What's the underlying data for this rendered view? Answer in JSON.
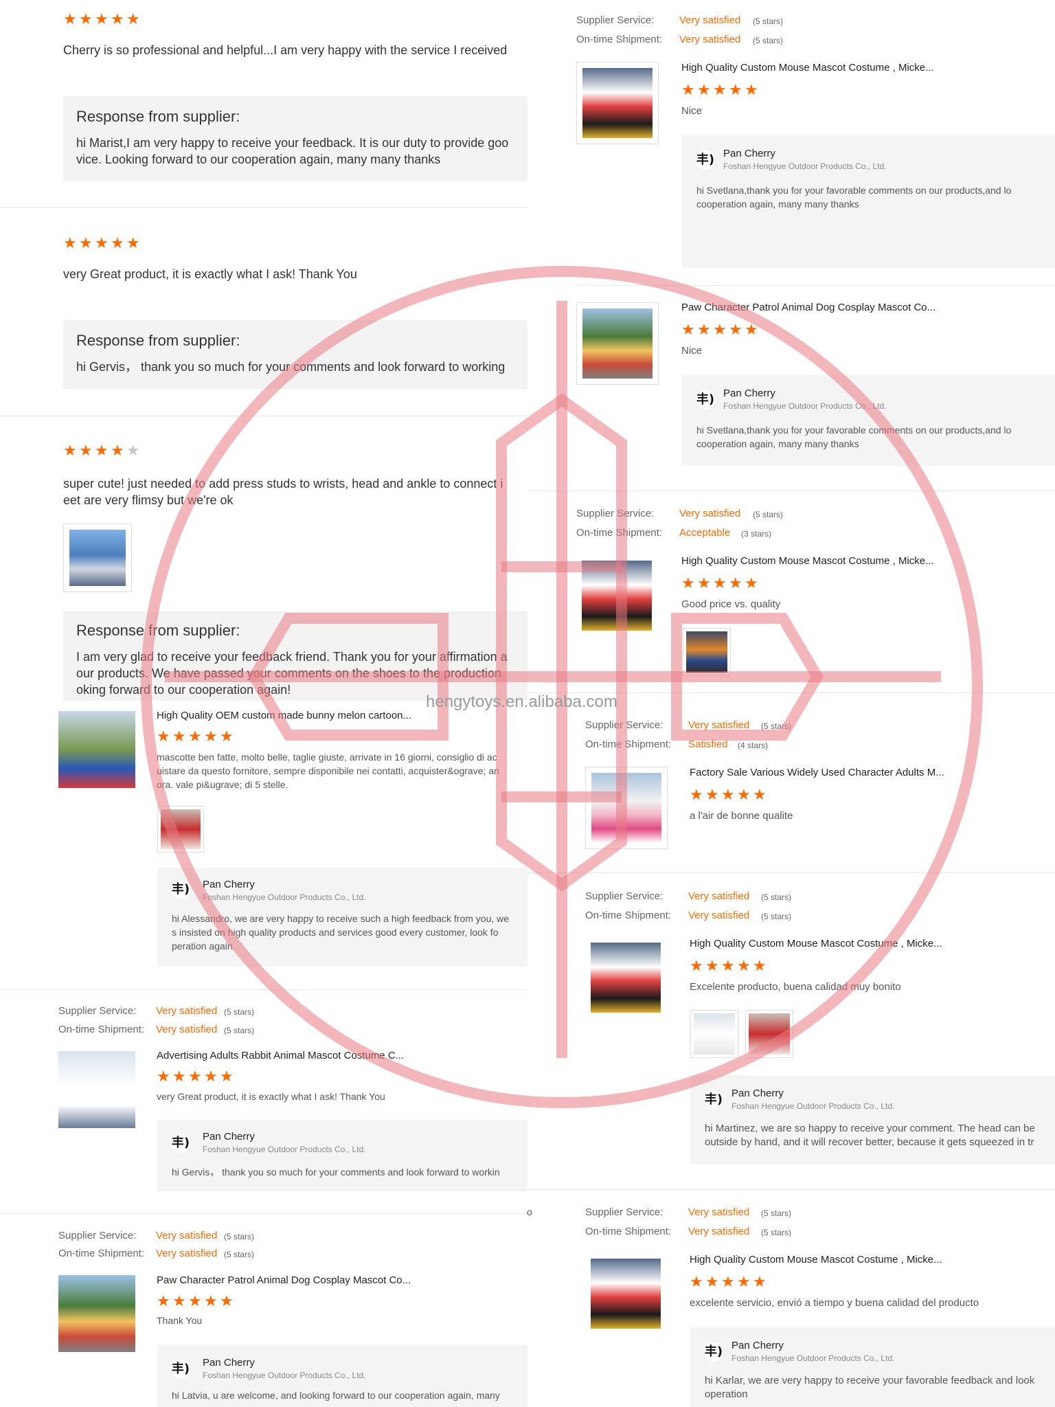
{
  "left": {
    "reviews": [
      {
        "rating": 5,
        "text": "Cherry is so professional and helpful...I am very happy with the service I received",
        "response_title": "Response from supplier:",
        "response_lines": [
          "hi Marist,I am very happy to receive your feedback. It is our duty to provide goo",
          "vice. Looking forward to our cooperation again, many many thanks"
        ]
      },
      {
        "rating": 5,
        "text": "very Great product, it is exactly what I ask! Thank You",
        "response_title": "Response from supplier:",
        "response_lines": [
          "hi Gervis， thank you so much for your comments and look forward to working"
        ]
      },
      {
        "rating": 4,
        "text_lines": [
          "super cute! just needed to add press studs to wrists, head and ankle to connect i",
          "eet are very flimsy but we're ok"
        ],
        "response_title": "Response from supplier:",
        "response_lines": [
          "I am very glad to receive your feedback friend. Thank you for your affirmation a",
          "our products. We have passed your comments on the shoes to the production",
          "oking forward to our cooperation again!"
        ]
      }
    ],
    "product_reviews": [
      {
        "title": "High Quality OEM custom made bunny melon cartoon...",
        "rating": 5,
        "text_lines": [
          "mascotte ben fatte, molto belle, taglie giuste, arrivate in 16 giorni, consiglio di ac",
          "uistare da questo fornitore, sempre disponibile nei contatti, acquister&ograve; an",
          "ora. vale pi&ugrave; di 5 stelle."
        ],
        "reply": {
          "name": "Pan Cherry",
          "company": "Foshan Hengyue Outdoor Products Co., Ltd.",
          "lines": [
            "hi Alessandro, we are very happy to receive such a high feedback from you, we",
            "s insisted on high quality products and services good every customer, look fo",
            "peration again"
          ]
        }
      },
      {
        "supplier_label": "Supplier Service:",
        "supplier_value": "Very satisfied",
        "supplier_stars": "(5 stars)",
        "shipment_label": "On-time Shipment:",
        "shipment_value": "Very satisfied",
        "shipment_stars": "(5 stars)",
        "title": "Advertising Adults Rabbit Animal Mascot Costume C...",
        "rating": 5,
        "text": "very Great product, it is exactly what I ask! Thank You",
        "reply": {
          "name": "Pan Cherry",
          "company": "Foshan Hengyue Outdoor Products Co., Ltd.",
          "lines": [
            "hi Gervis， thank you so much for your comments and look forward to workin"
          ]
        }
      },
      {
        "supplier_label": "Supplier Service:",
        "supplier_value": "Very satisfied",
        "supplier_stars": "(5 stars)",
        "shipment_label": "On-time Shipment:",
        "shipment_value": "Very satisfied",
        "shipment_stars": "(5 stars)",
        "title": "Paw Character Patrol Animal Dog Cosplay Mascot Co...",
        "rating": 5,
        "text": "Thank You",
        "reply": {
          "name": "Pan Cherry",
          "company": "Foshan Hengyue Outdoor Products Co., Ltd.",
          "lines": [
            "hi Latvia, u are welcome, and looking forward to our cooperation again, many"
          ]
        }
      }
    ],
    "stray_char": "o"
  },
  "right": {
    "top_meta": {
      "supplier_label": "Supplier Service:",
      "supplier_value": "Very satisfied",
      "supplier_stars": "(5 stars)",
      "shipment_label": "On-time Shipment:",
      "shipment_value": "Very satisfied",
      "shipment_stars": "(5 stars)"
    },
    "reviews": [
      {
        "title": "High Quality Custom Mouse Mascot Costume , Micke...",
        "rating": 5,
        "text": "Nice",
        "reply": {
          "name": "Pan Cherry",
          "company": "Foshan Hengyue Outdoor Products Co., Ltd.",
          "lines": [
            "hi Svetlana,thank you for your favorable comments on our products,and lo",
            "cooperation again, many many thanks"
          ]
        }
      },
      {
        "title": "Paw Character Patrol Animal Dog Cosplay Mascot Co...",
        "rating": 5,
        "text": "Nice",
        "reply": {
          "name": "Pan Cherry",
          "company": "Foshan Hengyue Outdoor Products Co., Ltd.",
          "lines": [
            "hi Svetlana,thank you for your favorable comments on our products,and lo",
            "cooperation again, many many thanks"
          ]
        }
      },
      {
        "supplier_label": "Supplier Service:",
        "supplier_value": "Very satisfied",
        "supplier_stars": "(5 stars)",
        "shipment_label": "On-time Shipment:",
        "shipment_value": "Acceptable",
        "shipment_stars": "(3 stars)",
        "title": "High Quality Custom Mouse Mascot Costume , Micke...",
        "rating": 5,
        "text": "Good price vs. quality"
      },
      {
        "supplier_label": "Supplier Service:",
        "supplier_value": "Very satisfied",
        "supplier_stars": "(5 stars)",
        "shipment_label": "On-time Shipment:",
        "shipment_value": "Satisfied",
        "shipment_stars": "(4 stars)",
        "title": "Factory Sale Various Widely Used Character Adults M...",
        "rating": 5,
        "text": "a l'air de bonne qualite"
      },
      {
        "supplier_label": "Supplier Service:",
        "supplier_value": "Very satisfied",
        "supplier_stars": "(5 stars)",
        "shipment_label": "On-time Shipment:",
        "shipment_value": "Very satisfied",
        "shipment_stars": "(5 stars)",
        "title": "High Quality Custom Mouse Mascot Costume , Micke...",
        "rating": 5,
        "text": "Excelente producto, buena calidad muy bonito",
        "reply": {
          "name": "Pan Cherry",
          "company": "Foshan Hengyue Outdoor Products Co., Ltd.",
          "lines": [
            "hi Martinez, we are so happy to receive your comment. The head can be",
            "outside by hand, and it will recover better, because it gets squeezed in tr"
          ]
        }
      },
      {
        "supplier_label": "Supplier Service:",
        "supplier_value": "Very satisfied",
        "supplier_stars": "(5 stars)",
        "shipment_label": "On-time Shipment:",
        "shipment_value": "Very satisfied",
        "shipment_stars": "(5 stars)",
        "title": "High Quality Custom Mouse Mascot Costume , Micke...",
        "rating": 5,
        "text": "excelente servicio, envió a tiempo y buena calidad del producto",
        "reply": {
          "name": "Pan Cherry",
          "company": "Foshan Hengyue Outdoor Products Co., Ltd.",
          "lines": [
            "hi Karlar, we are very happy to receive your favorable feedback and look",
            "operation"
          ]
        }
      }
    ]
  },
  "watermark": "hengytoys.en.alibaba.com",
  "logo_glyph": "丰)",
  "star_glyph": "★",
  "colors": {
    "accent": "#ff6a00",
    "watermark_red": "#e87a84"
  }
}
